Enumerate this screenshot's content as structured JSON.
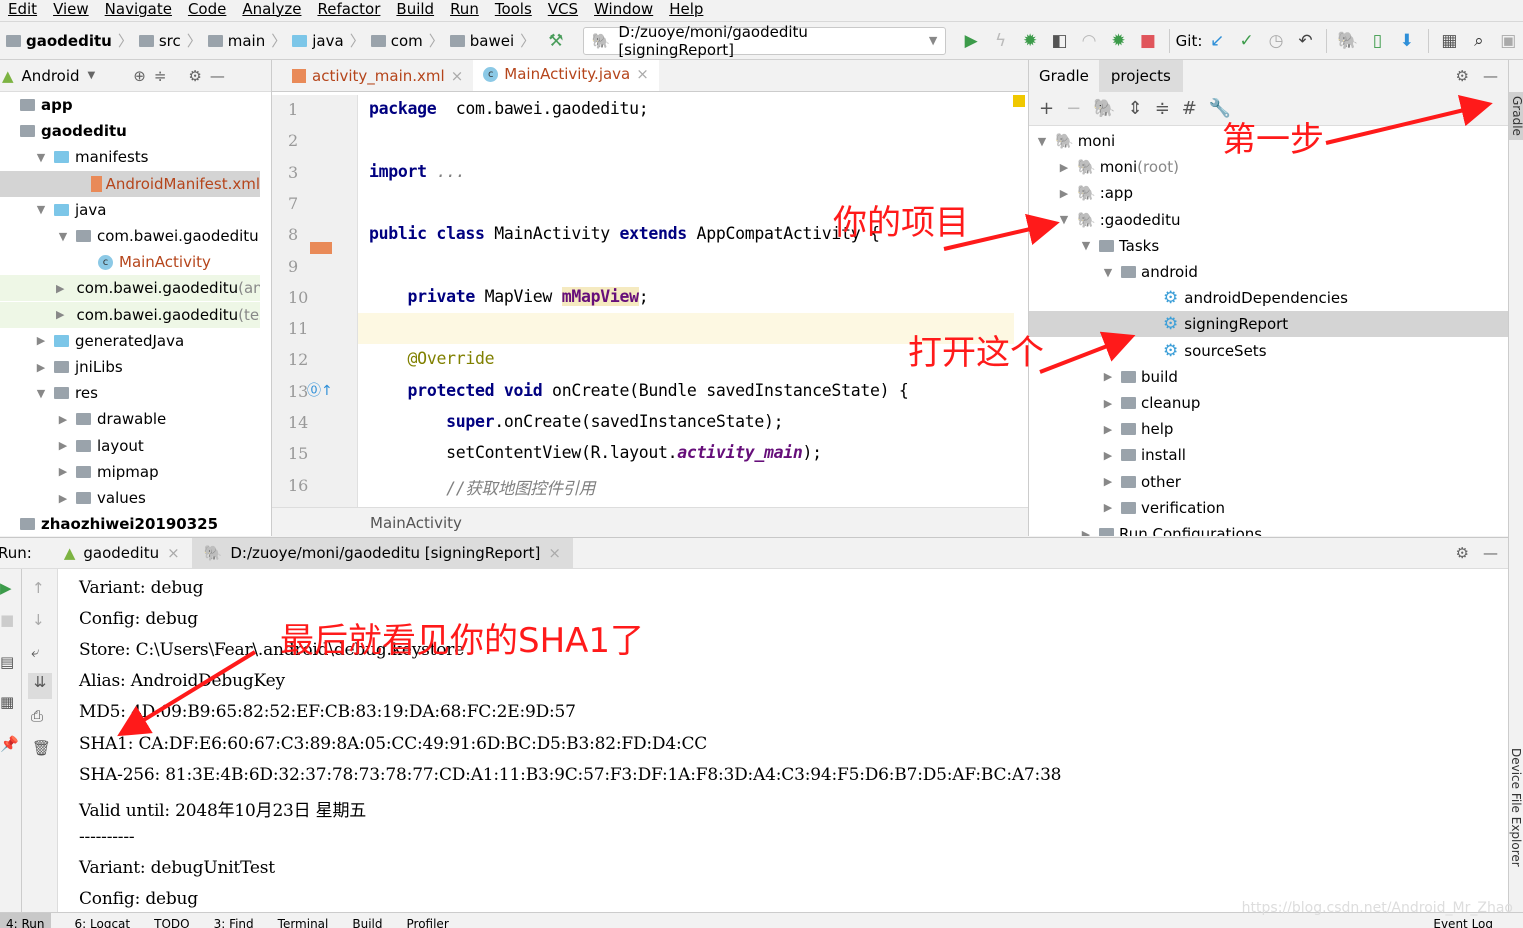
{
  "menu": [
    "Edit",
    "View",
    "Navigate",
    "Code",
    "Analyze",
    "Refactor",
    "Build",
    "Run",
    "Tools",
    "VCS",
    "Window",
    "Help"
  ],
  "breadcrumb": [
    "gaodeditu",
    "src",
    "main",
    "java",
    "com",
    "bawei"
  ],
  "run_config": "D:/zuoye/moni/gaodeditu [signingReport]",
  "git_label": "Git:",
  "project_panel": {
    "view": "Android",
    "tree": [
      {
        "label": "app",
        "indent": 0,
        "arrow": "",
        "bold": true,
        "icon": "module-folder-icon"
      },
      {
        "label": "gaodeditu",
        "indent": 0,
        "arrow": "",
        "bold": true,
        "icon": "module-folder-icon"
      },
      {
        "label": "manifests",
        "indent": 1,
        "arrow": "▼",
        "icon": "folder-icon"
      },
      {
        "label": "AndroidManifest.xml",
        "indent": 3,
        "arrow": "",
        "icon": "manifest-file-icon",
        "color": "#b5451b",
        "selected": true
      },
      {
        "label": "java",
        "indent": 1,
        "arrow": "▼",
        "icon": "folder-icon"
      },
      {
        "label": "com.bawei.gaodeditu",
        "indent": 2,
        "arrow": "▼",
        "icon": "package-icon"
      },
      {
        "label": "MainActivity",
        "indent": 3,
        "arrow": "",
        "icon": "class-icon",
        "color": "#b5451b"
      },
      {
        "label": "com.bawei.gaodeditu",
        "suffix": " (androidTest)",
        "indent": 2,
        "arrow": "▶",
        "icon": "package-icon",
        "green": true
      },
      {
        "label": "com.bawei.gaodeditu",
        "suffix": " (test)",
        "indent": 2,
        "arrow": "▶",
        "icon": "package-icon",
        "green": true
      },
      {
        "label": "generatedJava",
        "indent": 1,
        "arrow": "▶",
        "icon": "folder-icon"
      },
      {
        "label": "jniLibs",
        "indent": 1,
        "arrow": "▶",
        "icon": "resource-folder-icon"
      },
      {
        "label": "res",
        "indent": 1,
        "arrow": "▼",
        "icon": "resource-folder-icon"
      },
      {
        "label": "drawable",
        "indent": 2,
        "arrow": "▶",
        "icon": "package-icon"
      },
      {
        "label": "layout",
        "indent": 2,
        "arrow": "▶",
        "icon": "package-icon"
      },
      {
        "label": "mipmap",
        "indent": 2,
        "arrow": "▶",
        "icon": "package-icon"
      },
      {
        "label": "values",
        "indent": 2,
        "arrow": "▶",
        "icon": "package-icon"
      },
      {
        "label": "zhaozhiwei20190325",
        "indent": 0,
        "arrow": "",
        "bold": true,
        "icon": "module-folder-icon"
      }
    ]
  },
  "editor": {
    "tabs": [
      {
        "label": "activity_main.xml",
        "active": false
      },
      {
        "label": "MainActivity.java",
        "active": true
      }
    ],
    "lines": [
      {
        "n": "1",
        "segs": [
          [
            "kw",
            "package"
          ],
          [
            "",
            "  com.bawei.gaodeditu;"
          ]
        ]
      },
      {
        "n": "2",
        "segs": []
      },
      {
        "n": "3",
        "segs": [
          [
            "kw",
            "import"
          ],
          [
            "",
            " "
          ],
          [
            "cmt",
            "..."
          ]
        ]
      },
      {
        "n": "7",
        "segs": []
      },
      {
        "n": "8",
        "segs": [
          [
            "kw",
            "public class"
          ],
          [
            "",
            " MainActivity "
          ],
          [
            "kw",
            "extends"
          ],
          [
            "",
            " AppCompatActivity {"
          ]
        ]
      },
      {
        "n": "9",
        "segs": []
      },
      {
        "n": "10",
        "segs": [
          [
            "",
            "    "
          ],
          [
            "kw",
            "private"
          ],
          [
            "",
            " MapView "
          ],
          [
            "fld",
            "mMapView"
          ],
          [
            "",
            ";"
          ]
        ]
      },
      {
        "n": "11",
        "segs": []
      },
      {
        "n": "12",
        "segs": [
          [
            "",
            "    "
          ],
          [
            "ann",
            "@Override"
          ]
        ]
      },
      {
        "n": "13",
        "segs": [
          [
            "",
            "    "
          ],
          [
            "kw",
            "protected void"
          ],
          [
            "",
            " onCreate(Bundle savedInstanceState) {"
          ]
        ]
      },
      {
        "n": "14",
        "segs": [
          [
            "",
            "        "
          ],
          [
            "kw",
            "super"
          ],
          [
            "",
            ".onCreate(savedInstanceState);"
          ]
        ]
      },
      {
        "n": "15",
        "segs": [
          [
            "",
            "        setContentView(R.layout."
          ],
          [
            "ital",
            "activity_main"
          ],
          [
            "",
            ");"
          ]
        ]
      },
      {
        "n": "16",
        "segs": [
          [
            "",
            "        "
          ],
          [
            "cmt",
            "//获取地图控件引用"
          ]
        ]
      }
    ],
    "footer": "MainActivity"
  },
  "gradle": {
    "tabs": [
      "Gradle",
      "projects"
    ],
    "tree": [
      {
        "label": "moni",
        "indent": 0,
        "arrow": "▼",
        "icon": "elephant"
      },
      {
        "label": "moni",
        "suffix": " (root)",
        "indent": 1,
        "arrow": "▶",
        "icon": "elephant"
      },
      {
        "label": ":app",
        "indent": 1,
        "arrow": "▶",
        "icon": "elephant"
      },
      {
        "label": ":gaodeditu",
        "indent": 1,
        "arrow": "▼",
        "icon": "elephant"
      },
      {
        "label": "Tasks",
        "indent": 2,
        "arrow": "▼",
        "icon": "taskfolder"
      },
      {
        "label": "android",
        "indent": 3,
        "arrow": "▼",
        "icon": "taskfolder"
      },
      {
        "label": "androidDependencies",
        "indent": 4,
        "arrow": "",
        "icon": "gear"
      },
      {
        "label": "signingReport",
        "indent": 4,
        "arrow": "",
        "icon": "gear",
        "selected": true
      },
      {
        "label": "sourceSets",
        "indent": 4,
        "arrow": "",
        "icon": "gear"
      },
      {
        "label": "build",
        "indent": 3,
        "arrow": "▶",
        "icon": "taskfolder"
      },
      {
        "label": "cleanup",
        "indent": 3,
        "arrow": "▶",
        "icon": "taskfolder"
      },
      {
        "label": "help",
        "indent": 3,
        "arrow": "▶",
        "icon": "taskfolder"
      },
      {
        "label": "install",
        "indent": 3,
        "arrow": "▶",
        "icon": "taskfolder"
      },
      {
        "label": "other",
        "indent": 3,
        "arrow": "▶",
        "icon": "taskfolder"
      },
      {
        "label": "verification",
        "indent": 3,
        "arrow": "▶",
        "icon": "taskfolder"
      },
      {
        "label": "Run Configurations",
        "indent": 2,
        "arrow": "▶",
        "icon": "taskfolder"
      }
    ]
  },
  "side_tabs": {
    "gradle": "Gradle",
    "device_explorer": "Device File Explorer"
  },
  "run": {
    "label": "Run:",
    "tabs": [
      "gaodeditu",
      "D:/zuoye/moni/gaodeditu [signingReport]"
    ],
    "output": [
      "Variant: debug",
      "Config: debug",
      "Store: C:\\Users\\Fear\\.android\\debug.keystore",
      "Alias: AndroidDebugKey",
      "MD5: 4D:09:B9:65:82:52:EF:CB:83:19:DA:68:FC:2E:9D:57",
      "SHA1: CA:DF:E6:60:67:C3:89:8A:05:CC:49:91:6D:BC:D5:B3:82:FD:D4:CC",
      "SHA-256: 81:3E:4B:6D:32:37:78:73:78:77:CD:A1:11:B3:9C:57:F3:DF:1A:F8:3D:A4:C3:94:F5:D6:B7:D5:AF:BC:A7:38",
      "Valid until: 2048年10月23日 星期五",
      "----------",
      "Variant: debugUnitTest",
      "Config: debug"
    ]
  },
  "bottom_bar": [
    "4: Run",
    "6: Logcat",
    "TODO",
    "3: Find",
    "Terminal",
    "Build",
    "Profiler",
    "Event Log"
  ],
  "annotations": {
    "step1": "第一步",
    "your_project": "你的项目",
    "open_this": "打开这个",
    "result": "最后就看见你的SHA1了"
  },
  "watermark": "https://blog.csdn.net/Android_Mr_Zhao",
  "colors": {
    "annotation": "#ff1a1a",
    "keyword": "#000080",
    "selection": "#d4d4d4",
    "gear": "#3d9fd8"
  }
}
